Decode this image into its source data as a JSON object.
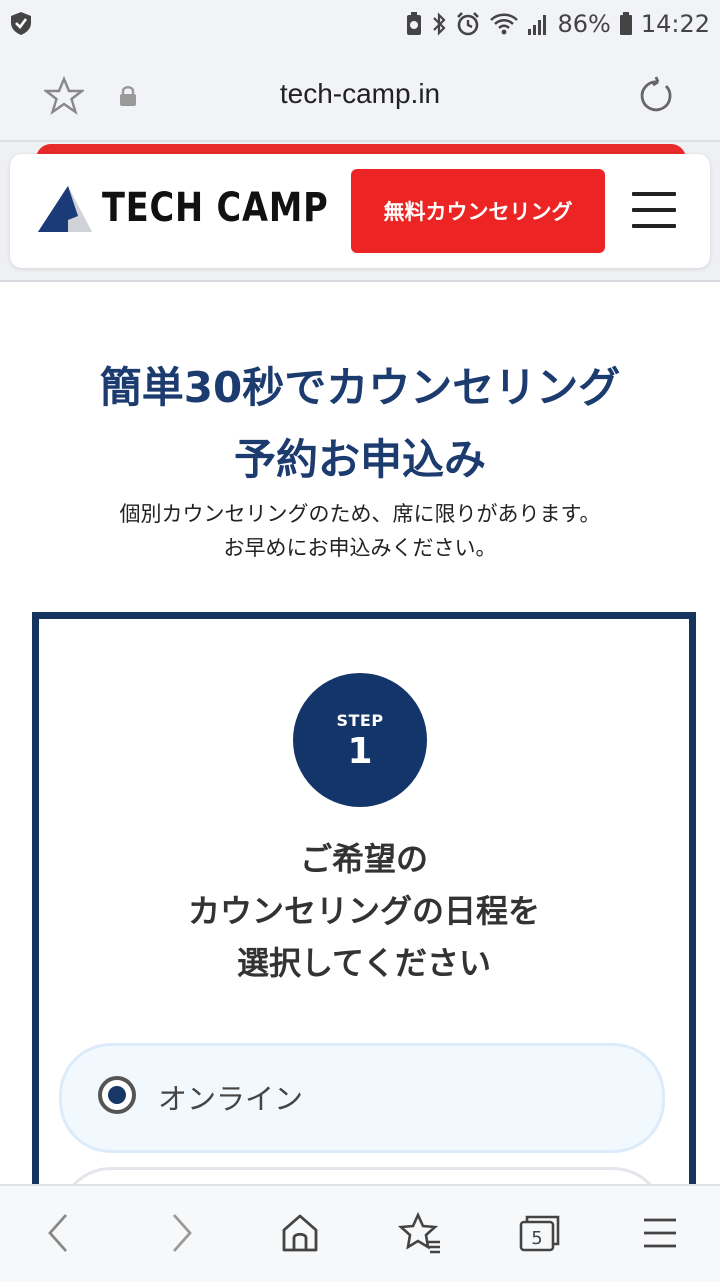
{
  "status_bar": {
    "battery": "86%",
    "time": "14:22"
  },
  "browser": {
    "url": "tech-camp.in",
    "tab_count": "5"
  },
  "header": {
    "logo_text": "TECH CAMP",
    "cta_label": "無料カウンセリング"
  },
  "hero": {
    "title_line1": "簡単30秒でカウンセリング",
    "title_line2": "予約お申込み",
    "subtitle_line1": "個別カウンセリングのため、席に限りがあります。",
    "subtitle_line2": "お早めにお申込みください。"
  },
  "form": {
    "step_label": "STEP",
    "step_number": "1",
    "heading_line1": "ご希望の",
    "heading_line2": "カウンセリングの日程を",
    "heading_line3": "選択してください",
    "options": [
      {
        "label": "オンライン",
        "selected": true
      }
    ]
  },
  "colors": {
    "brand_navy": "#17345f",
    "cta_red": "#ed2424"
  }
}
